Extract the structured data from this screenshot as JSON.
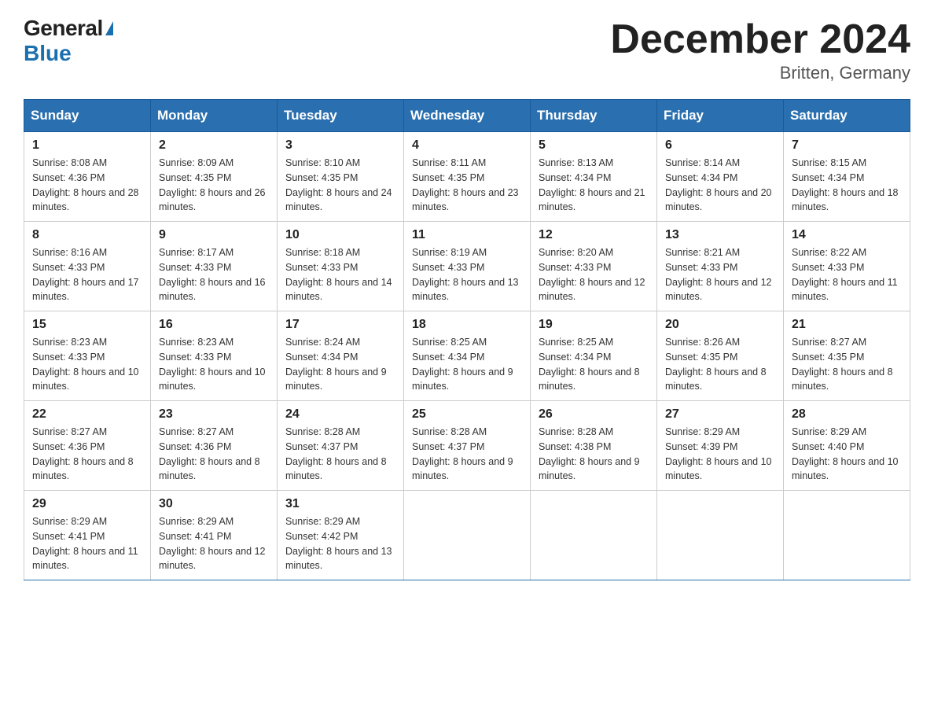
{
  "logo": {
    "general": "General",
    "blue": "Blue",
    "triangle": "▶"
  },
  "title": "December 2024",
  "subtitle": "Britten, Germany",
  "weekdays": [
    "Sunday",
    "Monday",
    "Tuesday",
    "Wednesday",
    "Thursday",
    "Friday",
    "Saturday"
  ],
  "weeks": [
    [
      {
        "day": "1",
        "sunrise": "8:08 AM",
        "sunset": "4:36 PM",
        "daylight": "8 hours and 28 minutes."
      },
      {
        "day": "2",
        "sunrise": "8:09 AM",
        "sunset": "4:35 PM",
        "daylight": "8 hours and 26 minutes."
      },
      {
        "day": "3",
        "sunrise": "8:10 AM",
        "sunset": "4:35 PM",
        "daylight": "8 hours and 24 minutes."
      },
      {
        "day": "4",
        "sunrise": "8:11 AM",
        "sunset": "4:35 PM",
        "daylight": "8 hours and 23 minutes."
      },
      {
        "day": "5",
        "sunrise": "8:13 AM",
        "sunset": "4:34 PM",
        "daylight": "8 hours and 21 minutes."
      },
      {
        "day": "6",
        "sunrise": "8:14 AM",
        "sunset": "4:34 PM",
        "daylight": "8 hours and 20 minutes."
      },
      {
        "day": "7",
        "sunrise": "8:15 AM",
        "sunset": "4:34 PM",
        "daylight": "8 hours and 18 minutes."
      }
    ],
    [
      {
        "day": "8",
        "sunrise": "8:16 AM",
        "sunset": "4:33 PM",
        "daylight": "8 hours and 17 minutes."
      },
      {
        "day": "9",
        "sunrise": "8:17 AM",
        "sunset": "4:33 PM",
        "daylight": "8 hours and 16 minutes."
      },
      {
        "day": "10",
        "sunrise": "8:18 AM",
        "sunset": "4:33 PM",
        "daylight": "8 hours and 14 minutes."
      },
      {
        "day": "11",
        "sunrise": "8:19 AM",
        "sunset": "4:33 PM",
        "daylight": "8 hours and 13 minutes."
      },
      {
        "day": "12",
        "sunrise": "8:20 AM",
        "sunset": "4:33 PM",
        "daylight": "8 hours and 12 minutes."
      },
      {
        "day": "13",
        "sunrise": "8:21 AM",
        "sunset": "4:33 PM",
        "daylight": "8 hours and 12 minutes."
      },
      {
        "day": "14",
        "sunrise": "8:22 AM",
        "sunset": "4:33 PM",
        "daylight": "8 hours and 11 minutes."
      }
    ],
    [
      {
        "day": "15",
        "sunrise": "8:23 AM",
        "sunset": "4:33 PM",
        "daylight": "8 hours and 10 minutes."
      },
      {
        "day": "16",
        "sunrise": "8:23 AM",
        "sunset": "4:33 PM",
        "daylight": "8 hours and 10 minutes."
      },
      {
        "day": "17",
        "sunrise": "8:24 AM",
        "sunset": "4:34 PM",
        "daylight": "8 hours and 9 minutes."
      },
      {
        "day": "18",
        "sunrise": "8:25 AM",
        "sunset": "4:34 PM",
        "daylight": "8 hours and 9 minutes."
      },
      {
        "day": "19",
        "sunrise": "8:25 AM",
        "sunset": "4:34 PM",
        "daylight": "8 hours and 8 minutes."
      },
      {
        "day": "20",
        "sunrise": "8:26 AM",
        "sunset": "4:35 PM",
        "daylight": "8 hours and 8 minutes."
      },
      {
        "day": "21",
        "sunrise": "8:27 AM",
        "sunset": "4:35 PM",
        "daylight": "8 hours and 8 minutes."
      }
    ],
    [
      {
        "day": "22",
        "sunrise": "8:27 AM",
        "sunset": "4:36 PM",
        "daylight": "8 hours and 8 minutes."
      },
      {
        "day": "23",
        "sunrise": "8:27 AM",
        "sunset": "4:36 PM",
        "daylight": "8 hours and 8 minutes."
      },
      {
        "day": "24",
        "sunrise": "8:28 AM",
        "sunset": "4:37 PM",
        "daylight": "8 hours and 8 minutes."
      },
      {
        "day": "25",
        "sunrise": "8:28 AM",
        "sunset": "4:37 PM",
        "daylight": "8 hours and 9 minutes."
      },
      {
        "day": "26",
        "sunrise": "8:28 AM",
        "sunset": "4:38 PM",
        "daylight": "8 hours and 9 minutes."
      },
      {
        "day": "27",
        "sunrise": "8:29 AM",
        "sunset": "4:39 PM",
        "daylight": "8 hours and 10 minutes."
      },
      {
        "day": "28",
        "sunrise": "8:29 AM",
        "sunset": "4:40 PM",
        "daylight": "8 hours and 10 minutes."
      }
    ],
    [
      {
        "day": "29",
        "sunrise": "8:29 AM",
        "sunset": "4:41 PM",
        "daylight": "8 hours and 11 minutes."
      },
      {
        "day": "30",
        "sunrise": "8:29 AM",
        "sunset": "4:41 PM",
        "daylight": "8 hours and 12 minutes."
      },
      {
        "day": "31",
        "sunrise": "8:29 AM",
        "sunset": "4:42 PM",
        "daylight": "8 hours and 13 minutes."
      },
      null,
      null,
      null,
      null
    ]
  ]
}
